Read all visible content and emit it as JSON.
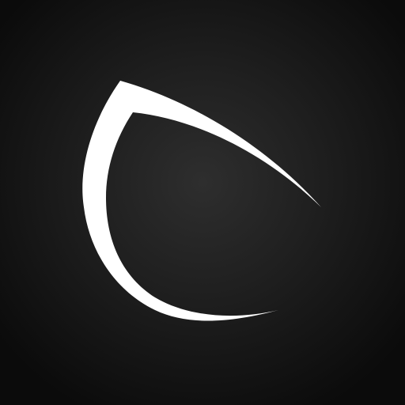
{
  "app_icon": {
    "icon": "crescent-eye-logo-icon",
    "colors": {
      "background_center": "#2e2e2e",
      "background_edge": "#0b0b0b",
      "mark": "#ffffff"
    }
  }
}
